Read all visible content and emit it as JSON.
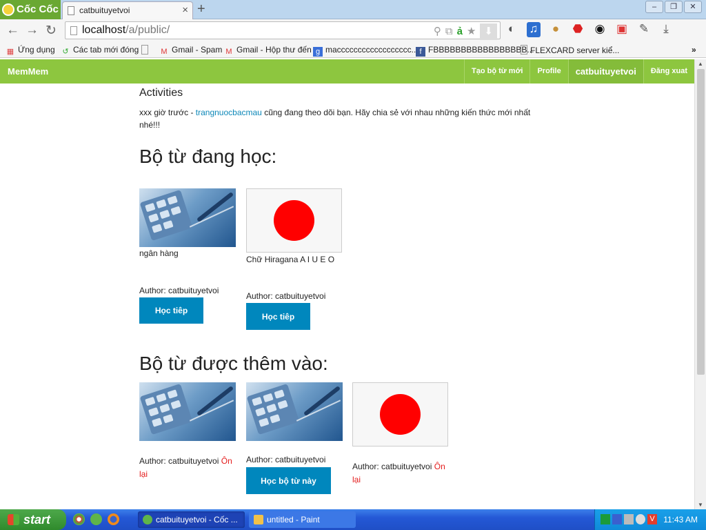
{
  "browser": {
    "brand": "Cốc Cốc",
    "tab_title": "catbuituyetvoi",
    "url_host": "localhost",
    "url_path": "/a/public/",
    "bookmarks": [
      "Ứng dụng",
      "Các tab mới đóng",
      "Gmail - Spam",
      "Gmail - Hộp thư đến",
      "macccccccccccccccccc...",
      "FBBBBBBBBBBBBBBBBB...",
      "FLEXCARD server kiể..."
    ]
  },
  "page": {
    "logo": "MemMem",
    "nav": {
      "create": "Tạo bộ từ mới",
      "profile": "Profile",
      "user": "catbuituyetvoi",
      "logout": "Đăng xuat"
    },
    "activities_title": "Activities",
    "activity": {
      "prefix": "xxx giờ trước - ",
      "user_link": "trangnuocbacmau",
      "suffix": " cũng đang theo dõi bạn. Hãy chia sẻ với nhau những kiến thức mới nhất nhé!!!"
    },
    "learning_title": "Bộ từ đang học:",
    "learning": [
      {
        "title": "ngân hàng",
        "author": "Author: catbuituyetvoi",
        "button": "Học tiêp",
        "image": "calculator-finance"
      },
      {
        "title": "Chữ Hiragana A I U E O",
        "author": "Author: catbuituyetvoi",
        "button": "Học tiêp",
        "image": "japan-flag"
      }
    ],
    "added_title": "Bộ từ được thêm vào:",
    "added": [
      {
        "author": "Author: catbuituyetvoi ",
        "review": "Ôn lại",
        "image": "calculator-finance"
      },
      {
        "author": "Author: catbuituyetvoi",
        "button": "Học bộ từ này",
        "image": "calculator-finance"
      },
      {
        "author": "Author: catbuituyetvoi ",
        "review": "Ôn lại",
        "image": "japan-flag"
      }
    ]
  },
  "taskbar": {
    "start": "start",
    "windows": [
      "catbuituyetvoi - Cốc ...",
      "untitled - Paint"
    ],
    "clock": "11:43 AM"
  }
}
